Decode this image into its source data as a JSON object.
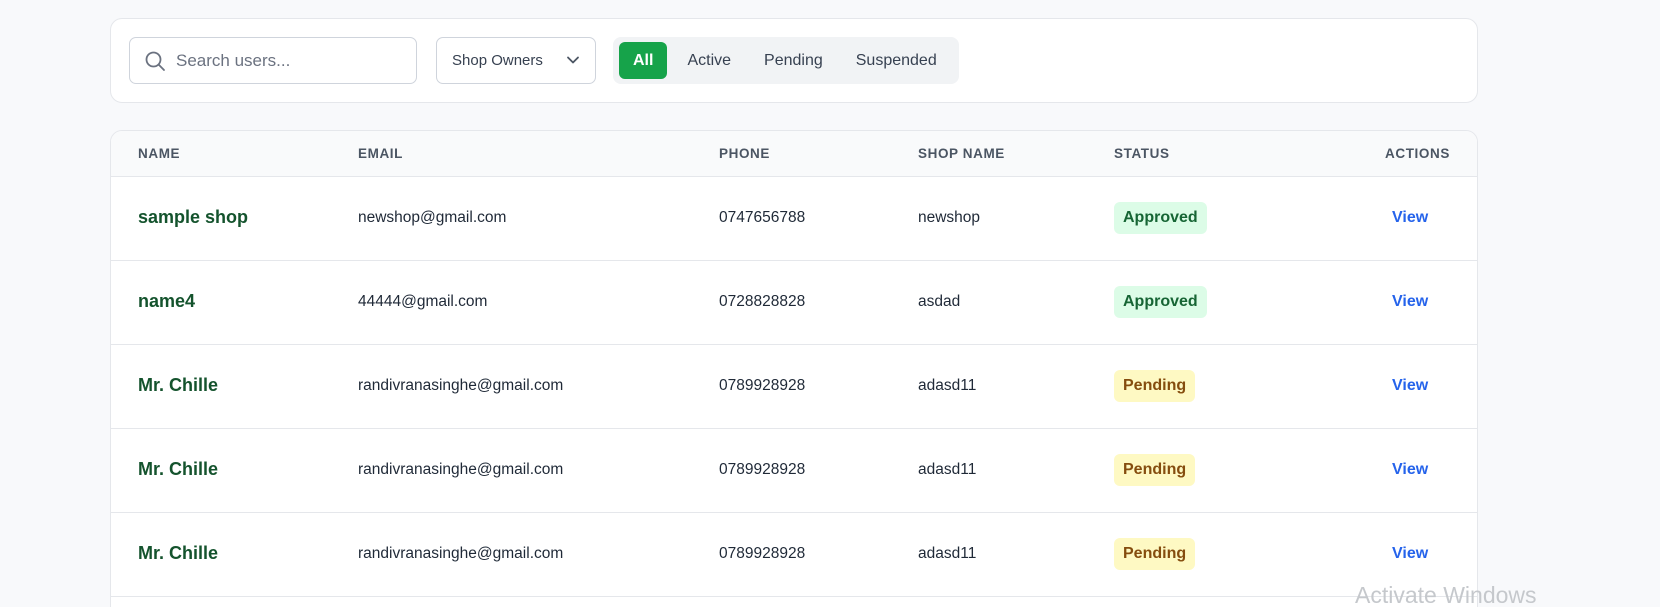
{
  "filters": {
    "search_placeholder": "Search users...",
    "role_select": "Shop Owners",
    "tabs": [
      {
        "label": "All",
        "active": true
      },
      {
        "label": "Active",
        "active": false
      },
      {
        "label": "Pending",
        "active": false
      },
      {
        "label": "Suspended",
        "active": false
      }
    ]
  },
  "table": {
    "columns": [
      "NAME",
      "EMAIL",
      "PHONE",
      "SHOP NAME",
      "STATUS",
      "ACTIONS"
    ],
    "rows": [
      {
        "name": "sample shop",
        "email": "newshop@gmail.com",
        "phone": "0747656788",
        "shop": "newshop",
        "status": "Approved",
        "action": "View"
      },
      {
        "name": "name4",
        "email": "44444@gmail.com",
        "phone": "0728828828",
        "shop": "asdad",
        "status": "Approved",
        "action": "View"
      },
      {
        "name": "Mr. Chille",
        "email": "randivranasinghe@gmail.com",
        "phone": "0789928928",
        "shop": "adasd11",
        "status": "Pending",
        "action": "View"
      },
      {
        "name": "Mr. Chille",
        "email": "randivranasinghe@gmail.com",
        "phone": "0789928928",
        "shop": "adasd11",
        "status": "Pending",
        "action": "View"
      },
      {
        "name": "Mr. Chille",
        "email": "randivranasinghe@gmail.com",
        "phone": "0789928928",
        "shop": "adasd11",
        "status": "Pending",
        "action": "View"
      }
    ]
  },
  "watermark": "Activate Windows",
  "colors": {
    "accent": "#16a34a",
    "link": "#2563eb",
    "approved_bg": "#dcfce7",
    "approved_fg": "#166534",
    "pending_bg": "#fef9c3",
    "pending_fg": "#854d0e"
  }
}
